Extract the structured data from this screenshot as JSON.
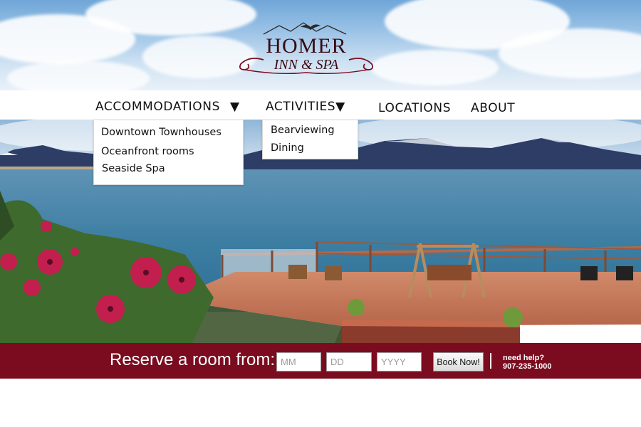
{
  "logo": {
    "name": "HOMER",
    "tagline": "INN & SPA"
  },
  "nav": {
    "accommodations": "ACCOMMODATIONS",
    "accommodations_arrow": "▼",
    "activities": "ACTIVITIES",
    "activities_arrow": "▼",
    "locations": "LOCATIONS",
    "about": "ABOUT"
  },
  "accommodations_menu": {
    "items": [
      {
        "label": "Downtown Townhouses"
      },
      {
        "label": "Oceanfront rooms"
      },
      {
        "label": "Seaside Spa"
      }
    ]
  },
  "activities_menu": {
    "items": [
      {
        "label": "Bearviewing"
      },
      {
        "label": "Dining"
      }
    ]
  },
  "reserve": {
    "label": "Reserve a room from:",
    "month_placeholder": "MM",
    "day_placeholder": "DD",
    "year_placeholder": "YYYY",
    "book_label": "Book Now!",
    "help_line1": "need help?",
    "help_line2": "907-235-1000"
  },
  "colors": {
    "brand_maroon": "#7b0c1f",
    "sky": "#9cc3e6",
    "water": "#3f7fa3",
    "deck": "#c8775a"
  }
}
